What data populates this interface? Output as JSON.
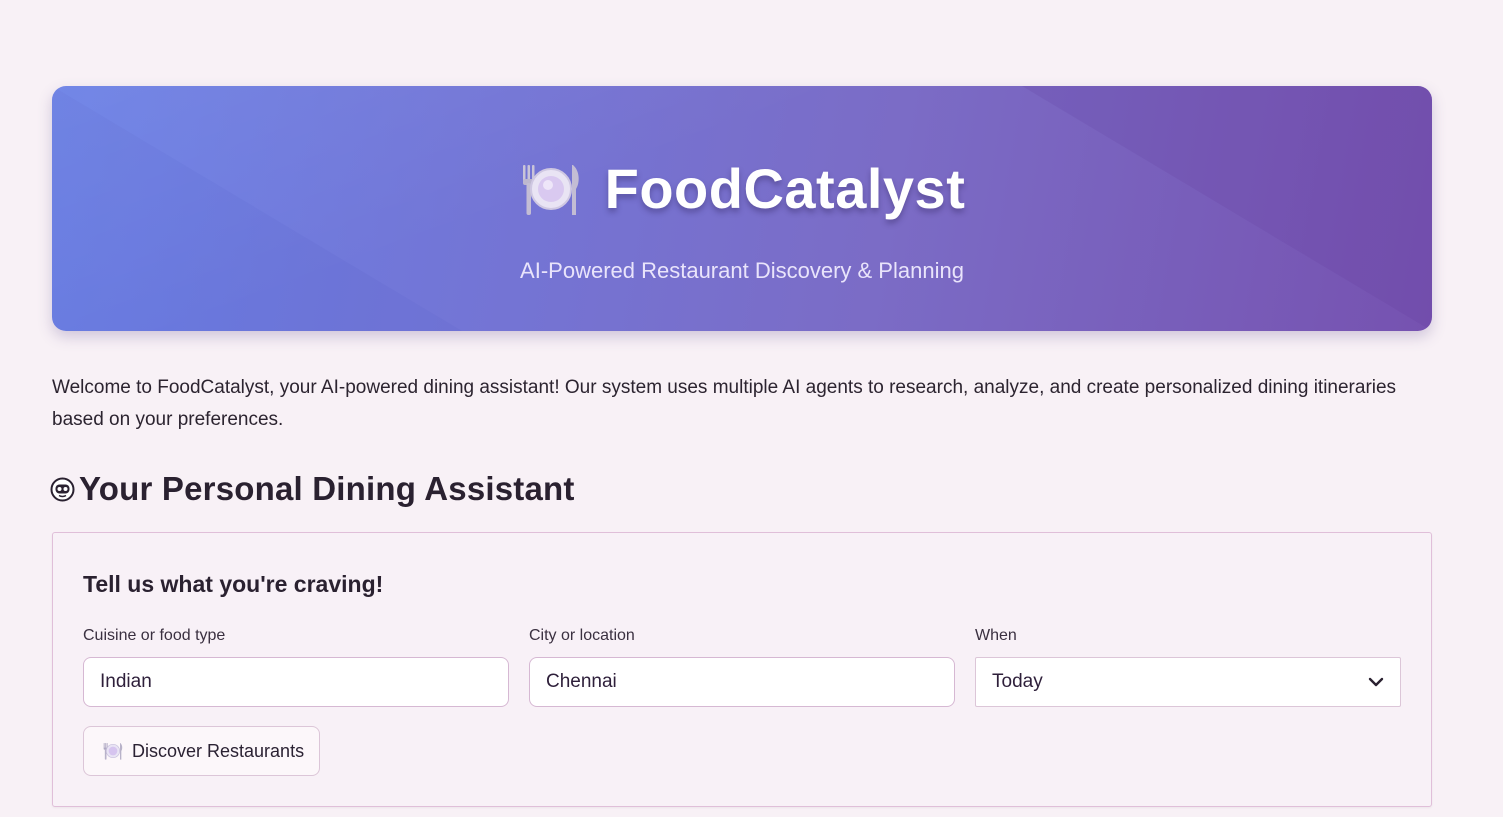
{
  "hero": {
    "title": "FoodCatalyst",
    "subtitle": "AI-Powered Restaurant Discovery & Planning",
    "icon": "plate-fork-knife-icon"
  },
  "intro": {
    "text": "Welcome to FoodCatalyst, your AI-powered dining assistant! Our system uses multiple AI agents to research, analyze, and create personalized dining itineraries based on your preferences."
  },
  "section": {
    "heading": "Your Personal Dining Assistant",
    "icon": "robot-face-icon"
  },
  "form": {
    "title": "Tell us what you're craving!",
    "cuisine": {
      "label": "Cuisine or food type",
      "value": "Indian"
    },
    "city": {
      "label": "City or location",
      "value": "Chennai"
    },
    "when": {
      "label": "When",
      "value": "Today"
    },
    "submit_label": "Discover Restaurants"
  },
  "colors": {
    "background": "#f8f1f6",
    "hero_start": "#6a80e6",
    "hero_end": "#7652b0",
    "card_border": "#e0bfd9"
  }
}
